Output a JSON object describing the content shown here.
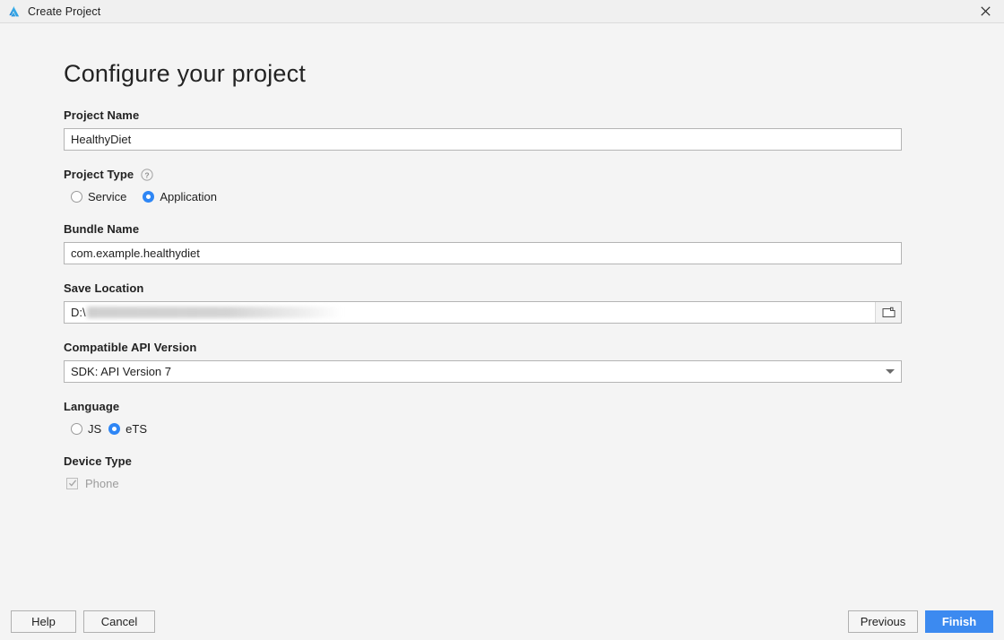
{
  "window": {
    "title": "Create Project",
    "logo_icon": "deveco-triangle-logo",
    "close_icon": "close-icon"
  },
  "page": {
    "heading": "Configure your project"
  },
  "form": {
    "project_name": {
      "label": "Project Name",
      "value": "HealthyDiet",
      "placeholder": ""
    },
    "project_type": {
      "label": "Project Type",
      "help_icon": "help-circle-icon",
      "options": [
        {
          "label": "Service",
          "selected": false
        },
        {
          "label": "Application",
          "selected": true
        }
      ]
    },
    "bundle_name": {
      "label": "Bundle Name",
      "value": "com.example.healthydiet",
      "placeholder": ""
    },
    "save_location": {
      "label": "Save Location",
      "value": "D:\\",
      "redacted": true,
      "browse_icon": "folder-icon"
    },
    "api_version": {
      "label": "Compatible API Version",
      "value": "SDK: API Version 7",
      "dropdown_icon": "chevron-down-icon"
    },
    "language": {
      "label": "Language",
      "options": [
        {
          "label": "JS",
          "selected": false
        },
        {
          "label": "eTS",
          "selected": true
        }
      ]
    },
    "device_type": {
      "label": "Device Type",
      "options": [
        {
          "label": "Phone",
          "checked": true,
          "disabled": true
        }
      ]
    }
  },
  "footer": {
    "help_label": "Help",
    "cancel_label": "Cancel",
    "previous_label": "Previous",
    "finish_label": "Finish"
  },
  "colors": {
    "accent": "#3c8af0",
    "radio_selected": "#2e86f5",
    "titlebar_bg": "#f0f0f0",
    "content_bg": "#f4f4f4",
    "field_bg": "#ffffff",
    "disabled_text": "#9c9c9c"
  }
}
